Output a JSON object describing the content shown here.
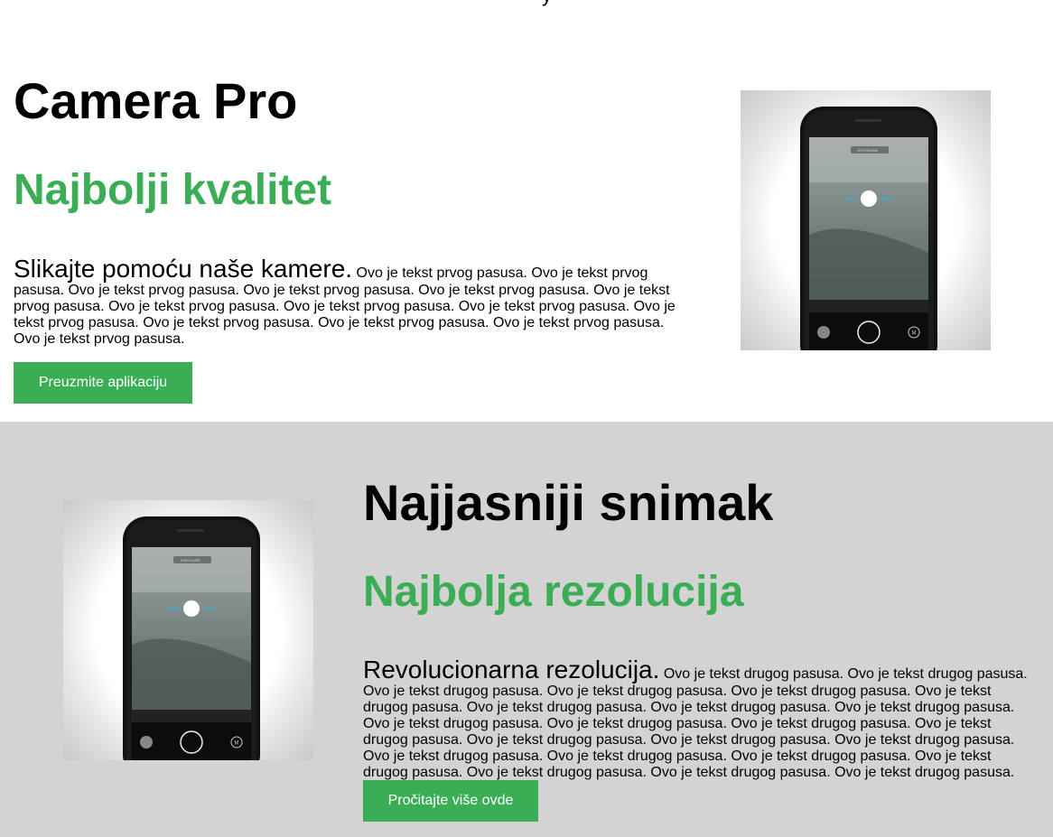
{
  "top_fragment": "y",
  "section1": {
    "title": "Camera Pro",
    "subtitle": "Najbolji kvalitet",
    "lead": "Slikajte pomoću naše kamere.",
    "body": " Ovo je tekst prvog pasusa. Ovo je tekst prvog pasusa. Ovo je tekst prvog pasusa. Ovo je tekst prvog pasusa. Ovo je tekst prvog pasusa. Ovo je tekst prvog pasusa. Ovo je tekst prvog pasusa. Ovo je tekst prvog pasusa. Ovo je tekst prvog pasusa. Ovo je tekst prvog pasusa. Ovo je tekst prvog pasusa. Ovo je tekst prvog pasusa. Ovo je tekst prvog pasusa. Ovo je tekst prvog pasusa.",
    "button": "Preuzmite aplikaciju"
  },
  "section2": {
    "title": "Najjasniji snimak",
    "subtitle": "Najbolja rezolucija",
    "lead": "Revolucionarna rezolucija.",
    "body": " Ovo je tekst drugog pasusa. Ovo je tekst drugog pasusa. Ovo je tekst drugog pasusa. Ovo je tekst drugog pasusa. Ovo je tekst drugog pasusa. Ovo je tekst drugog pasusa. Ovo je tekst drugog pasusa. Ovo je tekst drugog pasusa. Ovo je tekst drugog pasusa. Ovo je tekst drugog pasusa. Ovo je tekst drugog pasusa. Ovo je tekst drugog pasusa. Ovo je tekst drugog pasusa. Ovo je tekst drugog pasusa. Ovo je tekst drugog pasusa. Ovo je tekst drugog pasusa. Ovo je tekst drugog pasusa. Ovo je tekst drugog pasusa. Ovo je tekst drugog pasusa. Ovo je tekst drugog pasusa. Ovo je tekst drugog pasusa. Ovo je tekst drugog pasusa. Ovo je tekst drugog pasusa.",
    "button": "Pročitajte više ovde"
  },
  "colors": {
    "accent": "#3aad55",
    "section2_bg": "#d3d3d3"
  },
  "icons": [
    "phone-camera-image",
    "exposure-badge",
    "shutter-button-icon",
    "manual-mode-icon"
  ],
  "phone_ui": {
    "exposure_label": "EXPOSURE",
    "manual_label": "M"
  }
}
